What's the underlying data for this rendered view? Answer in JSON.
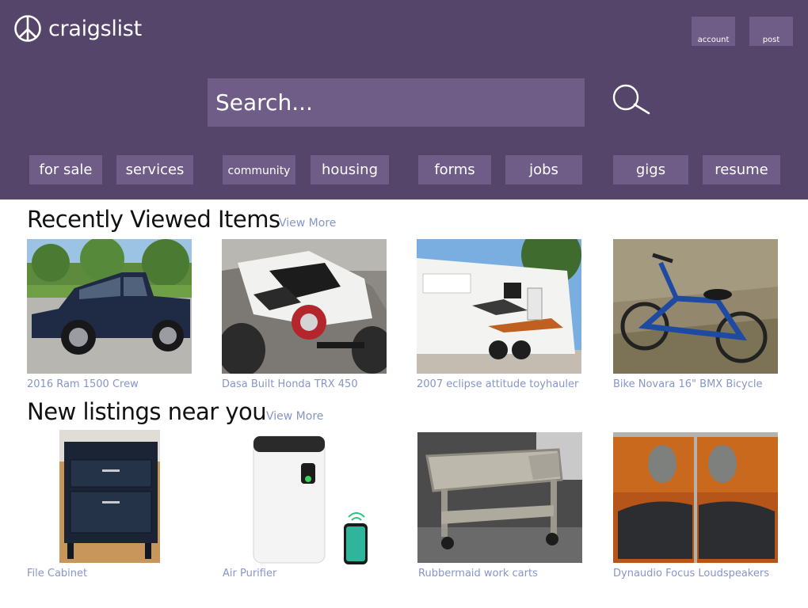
{
  "header": {
    "logo_text": "craigslist",
    "account_label": "account",
    "post_label": "post",
    "search_placeholder": "Search...",
    "categories": [
      "for sale",
      "services",
      "community",
      "housing",
      "forms",
      "jobs",
      "gigs",
      "resume"
    ]
  },
  "recent": {
    "title": "Recently Viewed Items",
    "view_more": "View More",
    "items": [
      {
        "label": "2016 Ram 1500 Crew"
      },
      {
        "label": "Dasa Built Honda TRX 450"
      },
      {
        "label": "2007 eclipse attitude toyhauler"
      },
      {
        "label": "Bike Novara 16\" BMX Bicycle"
      }
    ]
  },
  "nearby": {
    "title": "New listings near you",
    "view_more": "View More",
    "items": [
      {
        "label": "File Cabinet"
      },
      {
        "label": "Air Purifier"
      },
      {
        "label": "Rubbermaid work carts"
      },
      {
        "label": "Dynaudio Focus Loudspeakers"
      }
    ]
  },
  "colors": {
    "header_bg": "#55456b",
    "button_bg": "#6f5c87",
    "link": "#8795c8"
  }
}
